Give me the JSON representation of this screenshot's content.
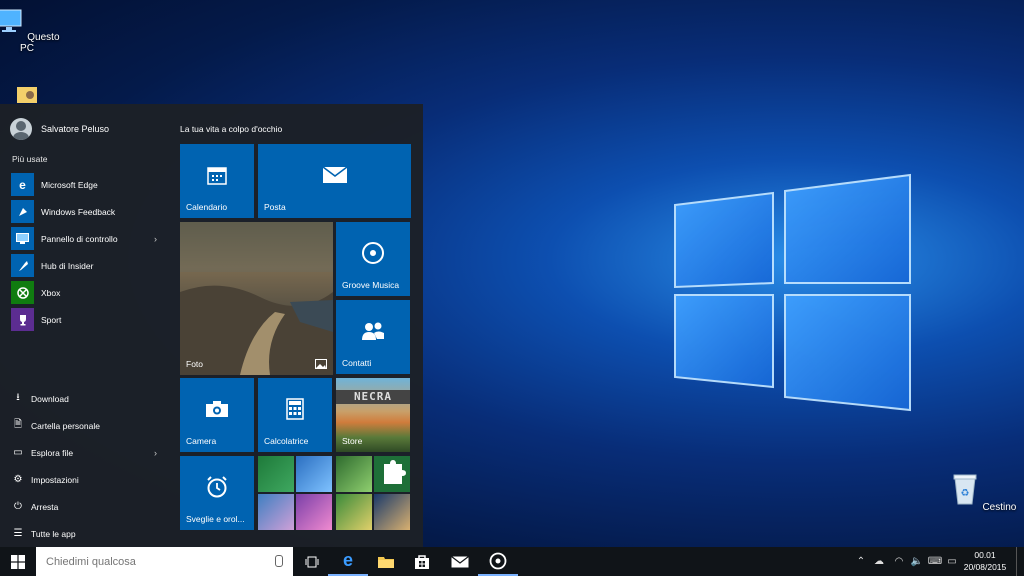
{
  "desktop": {
    "icons": [
      {
        "label": "Questo PC",
        "icon": "computer-icon"
      },
      {
        "label": "",
        "icon": "user-folder-icon"
      },
      {
        "label": "Cestino",
        "icon": "recycle-bin-icon"
      }
    ]
  },
  "start_menu": {
    "user_name": "Salvatore Peluso",
    "most_used_label": "Più usate",
    "apps": [
      {
        "label": "Microsoft Edge",
        "icon": "edge-icon",
        "color": "#0063b1"
      },
      {
        "label": "Windows Feedback",
        "icon": "feedback-icon",
        "color": "#0063b1"
      },
      {
        "label": "Pannello di controllo",
        "icon": "control-panel-icon",
        "color": "#0063b1",
        "has_submenu": true
      },
      {
        "label": "Hub di Insider",
        "icon": "insider-icon",
        "color": "#0063b1"
      },
      {
        "label": "Xbox",
        "icon": "xbox-icon",
        "color": "#107c10"
      },
      {
        "label": "Sport",
        "icon": "trophy-icon",
        "color": "#5c2d91"
      }
    ],
    "system": [
      {
        "label": "Download",
        "icon": "download-icon"
      },
      {
        "label": "Cartella personale",
        "icon": "personal-folder-icon"
      },
      {
        "label": "Esplora file",
        "icon": "file-explorer-icon",
        "has_submenu": true
      },
      {
        "label": "Impostazioni",
        "icon": "gear-icon"
      },
      {
        "label": "Arresta",
        "icon": "power-icon"
      },
      {
        "label": "Tutte le app",
        "icon": "all-apps-icon"
      }
    ],
    "tiles_header": "La tua vita a colpo d'occhio",
    "tiles": [
      {
        "label": "Calendario",
        "icon": "calendar-icon"
      },
      {
        "label": "Posta",
        "icon": "mail-icon"
      },
      {
        "label": "Foto",
        "icon": "photo-icon"
      },
      {
        "label": "Groove Musica",
        "icon": "groove-icon"
      },
      {
        "label": "Contatti",
        "icon": "people-icon"
      },
      {
        "label": "Camera",
        "icon": "camera-icon"
      },
      {
        "label": "Calcolatrice",
        "icon": "calculator-icon"
      },
      {
        "label": "Store",
        "icon": "store-icon"
      },
      {
        "label": "Sveglie e orol...",
        "icon": "alarm-icon"
      }
    ],
    "store_banner_text": "NECRA"
  },
  "taskbar": {
    "search_placeholder": "Chiedimi qualcosa",
    "apps": [
      "task-view-icon",
      "edge-icon",
      "file-explorer-icon",
      "store-icon",
      "mail-icon",
      "groove-icon"
    ],
    "clock_time": "00.01",
    "clock_date": "20/08/2015"
  },
  "colors": {
    "tile_blue": "#0063b1",
    "menu_bg": "#1c2026",
    "taskbar_bg": "#101418"
  }
}
